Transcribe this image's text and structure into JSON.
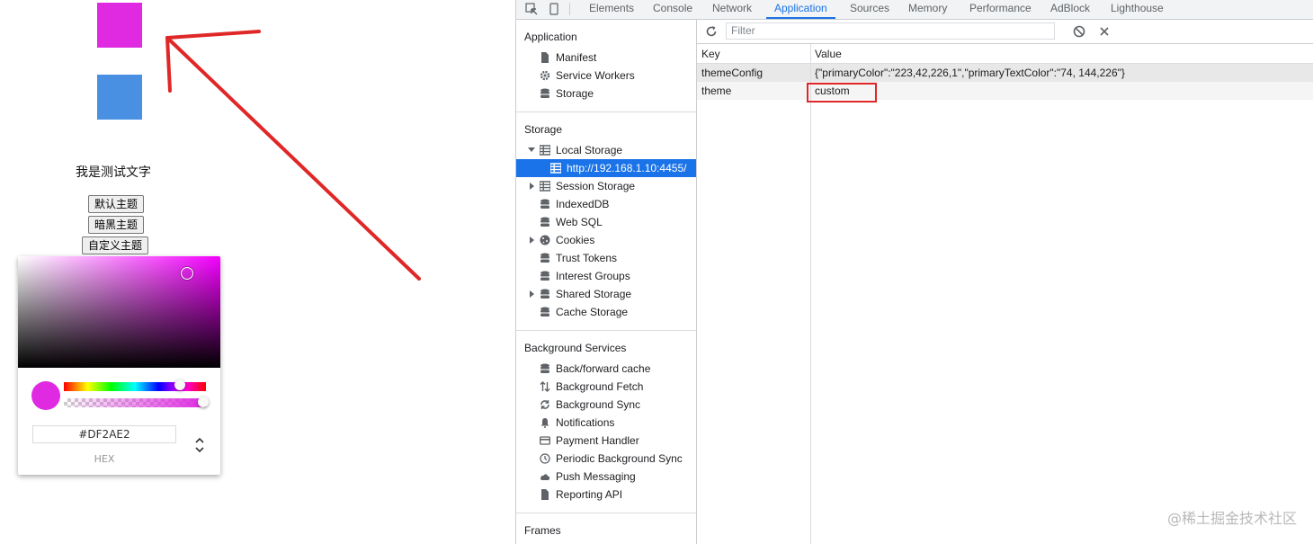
{
  "demo": {
    "square_colors": [
      "#df2ae2",
      "#4a90e2"
    ],
    "test_text": "我是测试文字",
    "buttons": [
      "默认主题",
      "暗黑主题",
      "自定义主题"
    ],
    "picker": {
      "hue_color": "#f500ff",
      "selected_color": "#DF2AE2",
      "hex_value": "#DF2AE2",
      "format_label": "HEX"
    }
  },
  "devtools": {
    "tabs": [
      "Elements",
      "Console",
      "Network",
      "Application",
      "Sources",
      "Memory",
      "Performance",
      "AdBlock",
      "Lighthouse"
    ],
    "active_tab": "Application",
    "sidebar": {
      "application": {
        "title": "Application",
        "items": [
          {
            "label": "Manifest",
            "icon": "document-icon"
          },
          {
            "label": "Service Workers",
            "icon": "gear-icon"
          },
          {
            "label": "Storage",
            "icon": "database-icon"
          }
        ]
      },
      "storage": {
        "title": "Storage",
        "items": [
          {
            "label": "Local Storage",
            "icon": "table-icon"
          },
          {
            "label": "http://192.168.1.10:4455/",
            "icon": "table-icon"
          },
          {
            "label": "Session Storage",
            "icon": "table-icon"
          },
          {
            "label": "IndexedDB",
            "icon": "database-icon"
          },
          {
            "label": "Web SQL",
            "icon": "database-icon"
          },
          {
            "label": "Cookies",
            "icon": "cookie-icon"
          },
          {
            "label": "Trust Tokens",
            "icon": "database-icon"
          },
          {
            "label": "Interest Groups",
            "icon": "database-icon"
          },
          {
            "label": "Shared Storage",
            "icon": "database-icon"
          },
          {
            "label": "Cache Storage",
            "icon": "database-icon"
          }
        ]
      },
      "background": {
        "title": "Background Services",
        "items": [
          {
            "label": "Back/forward cache",
            "icon": "database-icon"
          },
          {
            "label": "Background Fetch",
            "icon": "updown-arrows-icon"
          },
          {
            "label": "Background Sync",
            "icon": "sync-icon"
          },
          {
            "label": "Notifications",
            "icon": "bell-icon"
          },
          {
            "label": "Payment Handler",
            "icon": "card-icon"
          },
          {
            "label": "Periodic Background Sync",
            "icon": "clock-icon"
          },
          {
            "label": "Push Messaging",
            "icon": "cloud-icon"
          },
          {
            "label": "Reporting API",
            "icon": "document-icon"
          }
        ]
      },
      "frames_title": "Frames"
    },
    "filter_placeholder": "Filter",
    "table": {
      "headers": [
        "Key",
        "Value"
      ],
      "rows": [
        {
          "key": "themeConfig",
          "value": "{\"primaryColor\":\"223,42,226,1\",\"primaryTextColor\":\"74, 144,226\"}"
        },
        {
          "key": "theme",
          "value": "custom"
        }
      ]
    }
  },
  "watermark": "@稀土掘金技术社区",
  "annotation_color": "#e02727",
  "accent_color": "#1a73e8"
}
